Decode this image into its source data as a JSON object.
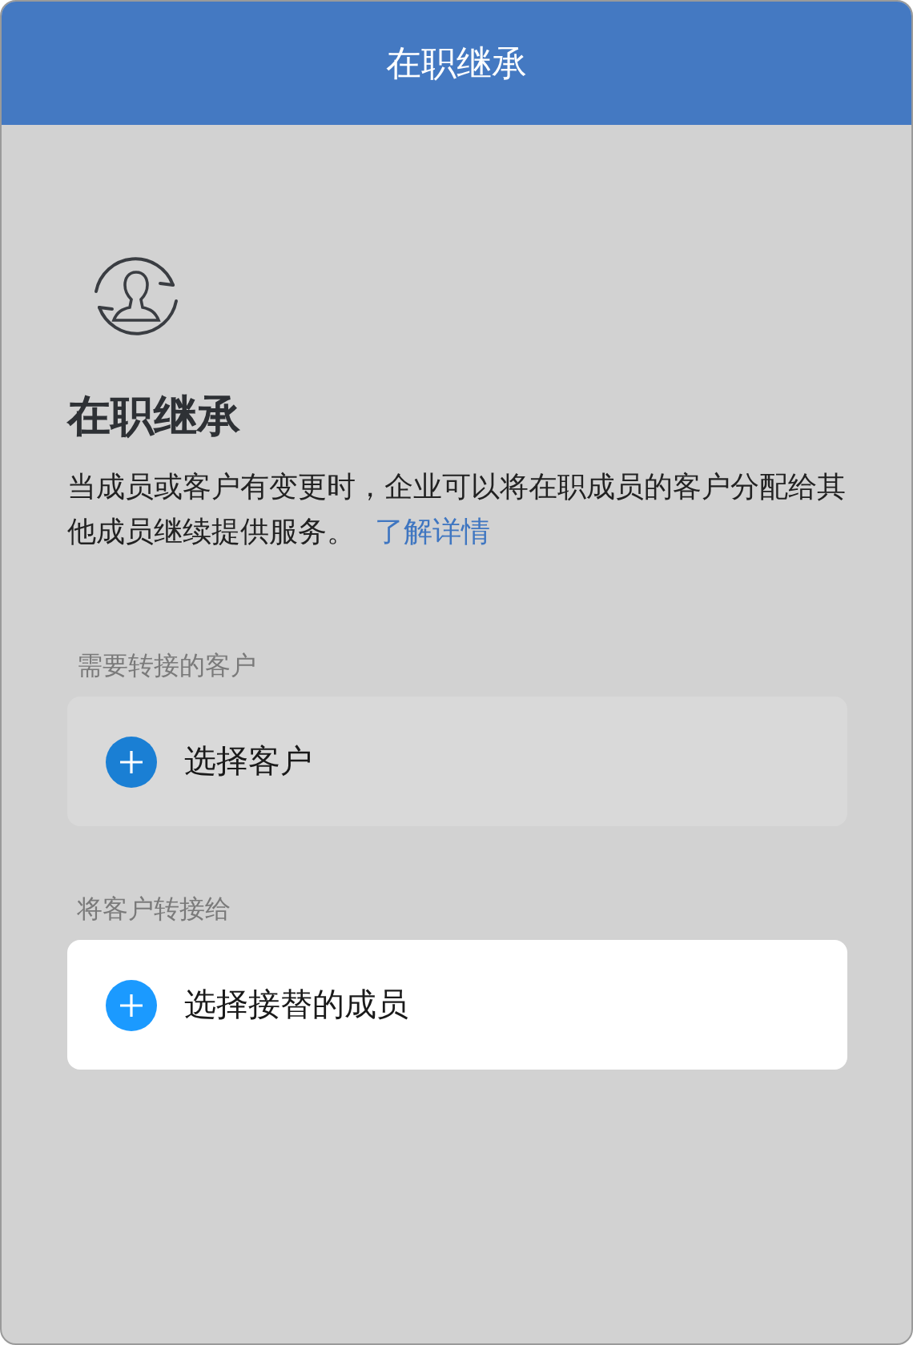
{
  "header": {
    "title": "在职继承"
  },
  "intro": {
    "heading": "在职继承",
    "description": "当成员或客户有变更时，企业可以将在职成员的客户分配给其他成员继续提供服务。",
    "link": "了解详情"
  },
  "sections": [
    {
      "label": "需要转接的客户",
      "action": "选择客户",
      "highlighted": false
    },
    {
      "label": "将客户转接给",
      "action": "选择接替的成员",
      "highlighted": true
    }
  ]
}
